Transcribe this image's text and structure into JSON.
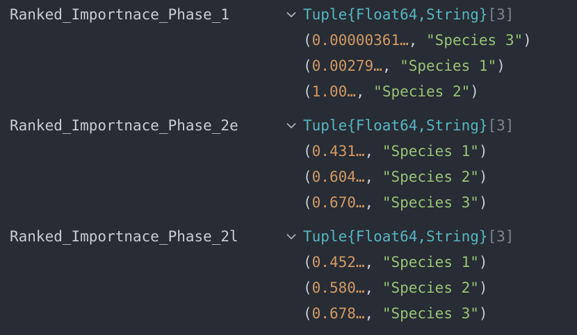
{
  "variables": [
    {
      "name": "Ranked_Importnace_Phase_1",
      "type": "Tuple{Float64,String}",
      "count": "[3]",
      "rows": [
        {
          "num": "0.00000361…",
          "str": "\"Species 3\""
        },
        {
          "num": "0.00279…",
          "str": "\"Species 1\""
        },
        {
          "num": "1.00…",
          "str": "\"Species 2\""
        }
      ]
    },
    {
      "name": "Ranked_Importnace_Phase_2e",
      "type": "Tuple{Float64,String}",
      "count": "[3]",
      "rows": [
        {
          "num": "0.431…",
          "str": "\"Species 1\""
        },
        {
          "num": "0.604…",
          "str": "\"Species 2\""
        },
        {
          "num": "0.670…",
          "str": "\"Species 3\""
        }
      ]
    },
    {
      "name": "Ranked_Importnace_Phase_2l",
      "type": "Tuple{Float64,String}",
      "count": "[3]",
      "rows": [
        {
          "num": "0.452…",
          "str": "\"Species 1\""
        },
        {
          "num": "0.580…",
          "str": "\"Species 2\""
        },
        {
          "num": "0.678…",
          "str": "\"Species 3\""
        }
      ]
    }
  ],
  "punct": {
    "open": "(",
    "sep": ", ",
    "close": ")"
  },
  "colors": {
    "background": "#282c34",
    "type": "#56b6c2",
    "number": "#d19a66",
    "string": "#98c379",
    "text": "#c8ccd4",
    "dim": "#7f848e"
  },
  "icons": {
    "toggle": "chevron-down-icon"
  }
}
